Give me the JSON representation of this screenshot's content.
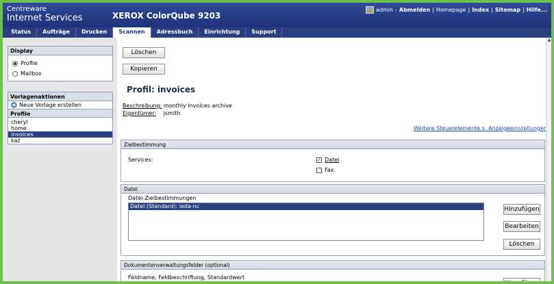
{
  "header": {
    "brand_line1": "Centreware",
    "brand_line2": "Internet Services",
    "model": "XEROX ColorQube 9203",
    "user": "admin",
    "separator": "-",
    "links": [
      "Abmelden",
      "Homepage",
      "Index",
      "Sitemap",
      "Hilfe..."
    ],
    "divider": "|"
  },
  "tabs": [
    {
      "label": "Status",
      "active": false
    },
    {
      "label": "Aufträge",
      "active": false
    },
    {
      "label": "Drucken",
      "active": false
    },
    {
      "label": "Scannen",
      "active": true
    },
    {
      "label": "Adressbuch",
      "active": false
    },
    {
      "label": "Einrichtung",
      "active": false
    },
    {
      "label": "Support",
      "active": false
    }
  ],
  "sidebar": {
    "display_title": "Display",
    "display_options": [
      {
        "label": "Profile",
        "selected": true
      },
      {
        "label": "Mailbox",
        "selected": false
      }
    ],
    "actions_title": "Vorlagenaktionen",
    "new_template": "Neue Vorlage erstellen",
    "profiles_title": "Profile",
    "profiles": [
      {
        "label": "cheryl",
        "selected": false
      },
      {
        "label": "home",
        "selected": false
      },
      {
        "label": "invoices",
        "selected": true
      },
      {
        "label": "kaz",
        "selected": false
      }
    ]
  },
  "main": {
    "delete_button": "Löschen",
    "copy_button": "Kopieren",
    "title": "Profil: invoices",
    "description_label": "Beschreibung:",
    "description_value": "monthly invoices archive",
    "owner_label": "Eigentümer:",
    "owner_value": "jsmith",
    "more_link": "Weitere Steuerelemente s. Anzeigeeinstellungen",
    "destination": {
      "title": "Zielbestimmung",
      "services_label": "Services:",
      "services": [
        {
          "label": "Datei",
          "checked": true
        },
        {
          "label": "Fax",
          "checked": false
        }
      ]
    },
    "file": {
      "title": "Datei",
      "list_label": "Datei-Zielbestimmungen",
      "items": [
        "Datei (Standard): leda-nc"
      ],
      "add_button": "Hinzufügen",
      "edit_button": "Bearbeiten",
      "delete_button": "Löschen"
    },
    "docfields": {
      "title": "Dokumentenverwaltungsfelder (optional)",
      "columns_label": "Feldname, Feldbeschriftung, Standardwert",
      "add_button": "Hinzufügen"
    }
  },
  "colors": {
    "header_blue": "#1d3278",
    "tab_bar": "#2a3f82",
    "selection": "#2a3f82",
    "frame_green": "#6cc24a",
    "link": "#1d4aa0"
  }
}
